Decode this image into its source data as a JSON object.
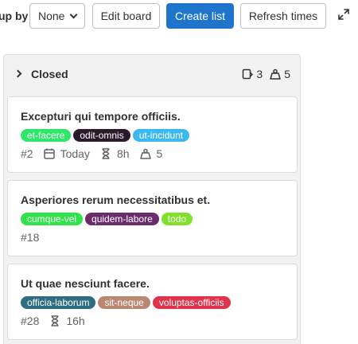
{
  "toolbar": {
    "group_by_label": "up by",
    "group_by_value": "None",
    "edit_board_label": "Edit board",
    "create_list_label": "Create list",
    "refresh_times_label": "Refresh times"
  },
  "column": {
    "title": "Closed",
    "issue_count": "3",
    "weight_total": "5"
  },
  "cards": [
    {
      "title": "Excepturi qui tempore officiis.",
      "labels": [
        {
          "text": "et-facere",
          "bg": "#2ee66a",
          "fg": "#ffffff"
        },
        {
          "text": "odit-omnis",
          "bg": "#2b1a2a",
          "fg": "#ffffff"
        },
        {
          "text": "ut-incidunt",
          "bg": "#3cb8f0",
          "fg": "#ffffff"
        }
      ],
      "id": "#2",
      "due": "Today",
      "time": "8h",
      "weight": "5"
    },
    {
      "title": "Asperiores rerum necessitatibus et.",
      "labels": [
        {
          "text": "cumque-vel",
          "bg": "#30e34a",
          "fg": "#ffffff"
        },
        {
          "text": "quidem-labore",
          "bg": "#6b2c6b",
          "fg": "#ffffff"
        },
        {
          "text": "todo",
          "bg": "#7fe12c",
          "fg": "#ffffff"
        }
      ],
      "id": "#18"
    },
    {
      "title": "Ut quae nesciunt facere.",
      "labels": [
        {
          "text": "officia-laborum",
          "bg": "#2f6d80",
          "fg": "#ffffff"
        },
        {
          "text": "sit-neque",
          "bg": "#b88872",
          "fg": "#ffffff"
        },
        {
          "text": "voluptas-officiis",
          "bg": "#e0344c",
          "fg": "#ffffff"
        }
      ],
      "id": "#28",
      "time": "16h"
    }
  ],
  "colors": {
    "primary": "#1f75cb",
    "column_bg": "#f2f2f2",
    "border": "#dcdcde"
  },
  "icons": {
    "expand": "expand-icon",
    "issues": "issues-icon",
    "weight": "weight-icon",
    "calendar": "calendar-icon",
    "hourglass": "hourglass-icon",
    "chevron": "chevron-down-icon"
  }
}
